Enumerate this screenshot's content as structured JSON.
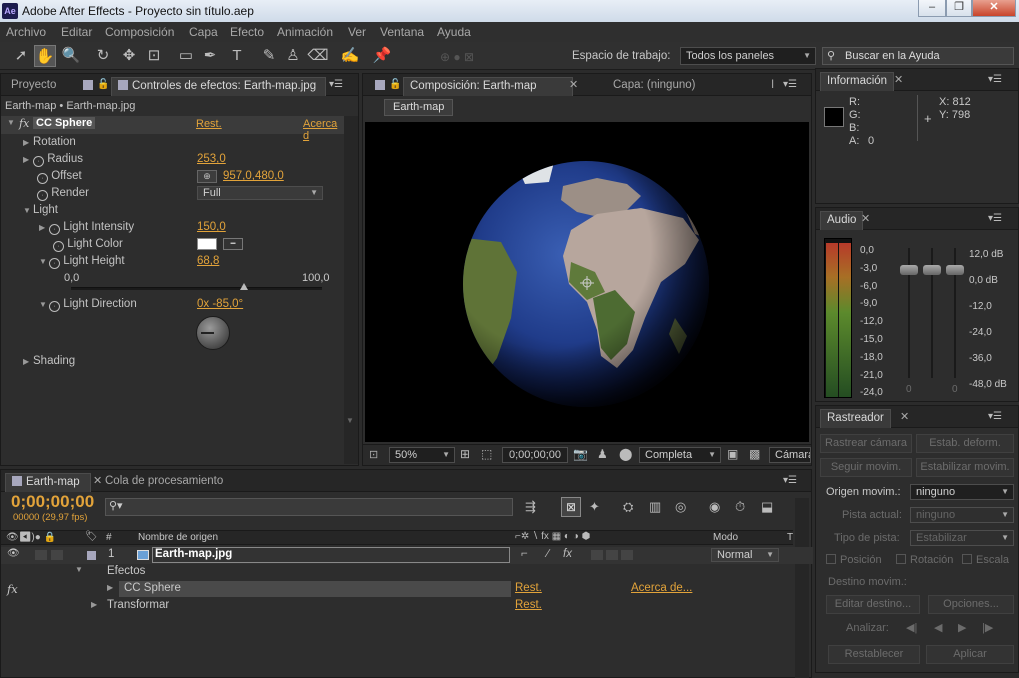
{
  "window": {
    "app_badge": "Ae",
    "title": "Adobe After Effects - Proyecto sin título.aep",
    "min": "‒",
    "max": "❐",
    "close": "✕"
  },
  "menu": [
    "Archivo",
    "Editar",
    "Composición",
    "Capa",
    "Efecto",
    "Animación",
    "Ver",
    "Ventana",
    "Ayuda"
  ],
  "toolbar": {
    "tools": [
      "select-tool",
      "hand-tool",
      "zoom-tool",
      "rotate-tool",
      "camera-orbit-tool",
      "pan-behind-tool",
      "rectangle-tool",
      "pen-tool",
      "type-tool",
      "brush-tool",
      "clone-stamp-tool",
      "eraser-tool",
      "roto-brush-tool",
      "puppet-pin-tool"
    ],
    "workspace_label": "Espacio de trabajo:",
    "workspace_value": "Todos los paneles",
    "search_placeholder": "Buscar en la Ayuda"
  },
  "effects_panel": {
    "tab_project": "Proyecto",
    "tab_effects": "Controles de efectos: Earth-map.jpg",
    "breadcrumb": "Earth-map • Earth-map.jpg",
    "fx_label": "fx",
    "effect_name": "CC Sphere",
    "reset": "Rest.",
    "about": "Acerca d",
    "rotation": "Rotation",
    "radius": "Radius",
    "radius_value": "253,0",
    "offset": "Offset",
    "offset_value": "957,0,480,0",
    "render": "Render",
    "render_value": "Full",
    "light": "Light",
    "light_intensity": "Light Intensity",
    "light_intensity_value": "150,0",
    "light_color": "Light Color",
    "light_height": "Light Height",
    "light_height_value": "68,8",
    "slider_min": "0,0",
    "slider_max": "100,0",
    "slider_pos": 0.688,
    "light_direction": "Light Direction",
    "light_direction_value": "0x -85,0°",
    "shading": "Shading"
  },
  "comp_panel": {
    "tab_comp": "Composición: Earth-map",
    "tab_layer": "Capa: (ninguno)",
    "tab_extra": "I",
    "comp_button": "Earth-map",
    "zoom": "50%",
    "timecode": "0;00;00;00",
    "resolution": "Completa",
    "camera": "Cámara"
  },
  "info_panel": {
    "tab": "Información",
    "r": "R:",
    "g": "G:",
    "b": "B:",
    "a": "A:",
    "a_value": "0",
    "x": "X: 812",
    "y": "Y: 798"
  },
  "audio_panel": {
    "tab": "Audio",
    "left_scale": [
      "0,0",
      "-3,0",
      "-6,0",
      "-9,0",
      "-12,0",
      "-15,0",
      "-18,0",
      "-21,0",
      "-24,0"
    ],
    "right_scale": [
      "12,0 dB",
      "0,0 dB",
      "-12,0",
      "-24,0",
      "-36,0",
      "-48,0 dB"
    ],
    "zero_left": "0",
    "zero_right": "0"
  },
  "tracker_panel": {
    "tab": "Rastreador",
    "track_camera": "Rastrear cámara",
    "stabilize_warp": "Estab. deform.",
    "track_motion": "Seguir movim.",
    "stabilize_motion": "Estabilizar movim.",
    "motion_source_label": "Origen movim.:",
    "motion_source_value": "ninguno",
    "current_track_label": "Pista actual:",
    "current_track_value": "ninguno",
    "track_type_label": "Tipo de pista:",
    "track_type_value": "Estabilizar",
    "position": "Posición",
    "rotation": "Rotación",
    "scale": "Escala",
    "motion_target": "Destino movim.:",
    "edit_target": "Editar destino...",
    "options": "Opciones...",
    "analyze": "Analizar:",
    "reset": "Restablecer",
    "apply": "Aplicar"
  },
  "timeline": {
    "tab_comp": "Earth-map",
    "tab_render": "Cola de procesamiento",
    "timecode": "0;00;00;00",
    "frames": "00000 (29,97 fps)",
    "search_placeholder": "",
    "col_num": "#",
    "col_source": "Nombre de origen",
    "col_mode": "Modo",
    "col_t": "T",
    "layer_num": "1",
    "layer_name": "Earth-map.jpg",
    "layer_mode": "Normal",
    "effects": "Efectos",
    "fx": "fx",
    "effect_name": "CC Sphere",
    "reset": "Rest.",
    "about": "Acerca de...",
    "transform": "Transformar",
    "reset2": "Rest."
  }
}
